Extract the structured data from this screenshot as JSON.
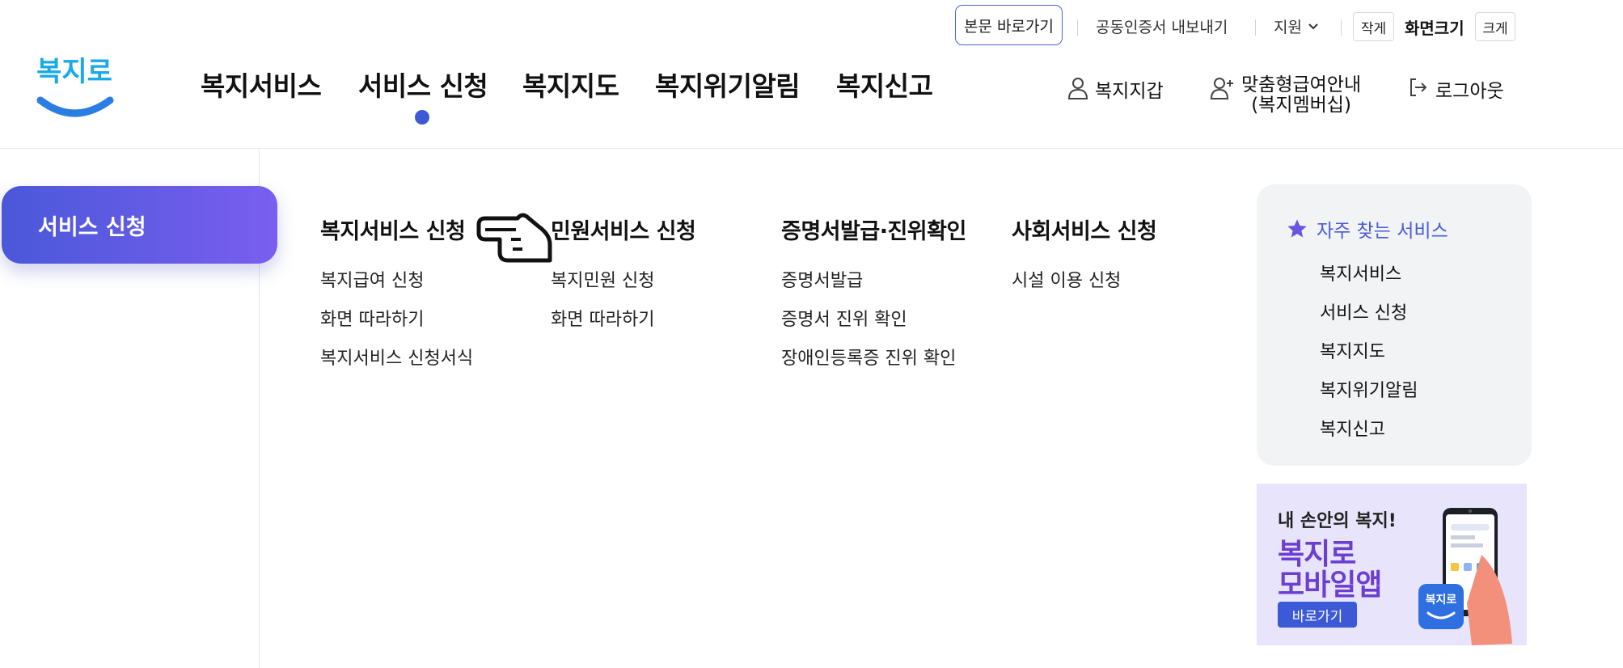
{
  "utility": {
    "skip_to_content": "본문 바로가기",
    "export_certificate": "공동인증서 내보내기",
    "support": "지원",
    "size_small": "작게",
    "screen_size": "화면크기",
    "size_large": "크게"
  },
  "logo": {
    "text": "복지로"
  },
  "nav": {
    "items": [
      "복지서비스",
      "서비스 신청",
      "복지지도",
      "복지위기알림",
      "복지신고"
    ],
    "active_index": 1
  },
  "user_links": {
    "wallet": "복지지갑",
    "membership_line1": "맞춤형급여안내",
    "membership_line2": "(복지멤버십)",
    "logout": "로그아웃"
  },
  "side": {
    "current_section": "서비스 신청"
  },
  "mega_menu": {
    "columns": [
      {
        "title": "복지서비스 신청",
        "links": [
          "복지급여 신청",
          "화면 따라하기",
          "복지서비스 신청서식"
        ]
      },
      {
        "title": "민원서비스 신청",
        "links": [
          "복지민원 신청",
          "화면 따라하기"
        ]
      },
      {
        "title": "증명서발급·진위확인",
        "links": [
          "증명서발급",
          "증명서 진위 확인",
          "장애인등록증 진위 확인"
        ]
      },
      {
        "title": "사회서비스 신청",
        "links": [
          "시설 이용 신청"
        ]
      }
    ]
  },
  "frequent": {
    "title": "자주 찾는 서비스",
    "items": [
      "복지서비스",
      "서비스 신청",
      "복지지도",
      "복지위기알림",
      "복지신고"
    ]
  },
  "banner": {
    "tagline": "내 손안의 복지!",
    "headline_line1": "복지로",
    "headline_line2": "모바일앱",
    "button": "바로가기",
    "app_icon_text": "복지로"
  },
  "colors": {
    "accent": "#3d5ad6",
    "pill_gradient_start": "#4a58d8",
    "pill_gradient_end": "#7a5ef0",
    "banner_bg": "#e8e4fb",
    "banner_headline": "#6b3fd1",
    "panel_bg": "#f1f3f5"
  }
}
